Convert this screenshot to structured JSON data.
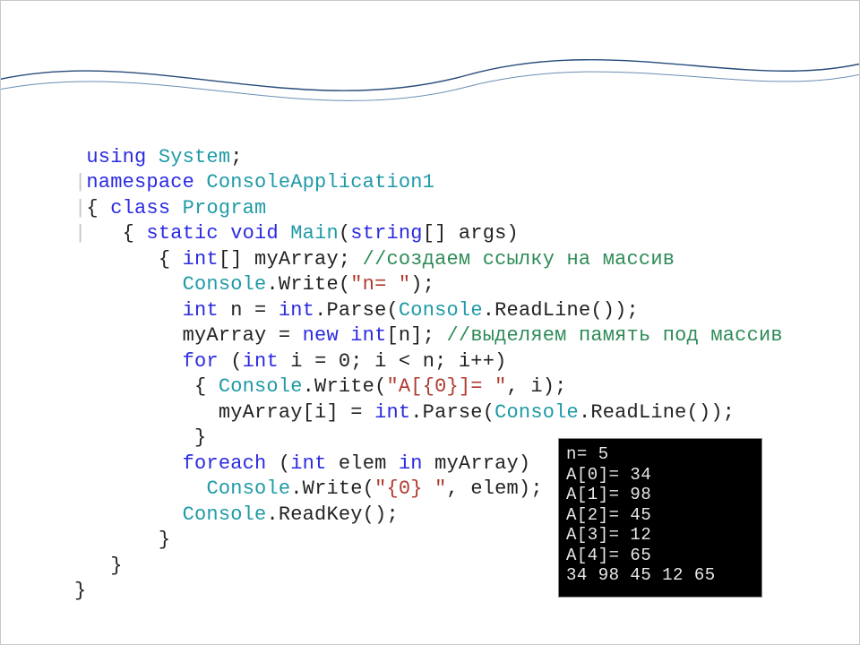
{
  "code": {
    "l1_kw": "using",
    "l1_type": " System",
    "l1_plain": ";",
    "l2_guide": "|",
    "l2_kw": "namespace",
    "l2_type": " ConsoleApplication1",
    "l3_guide": "|",
    "l3_p1": "{ ",
    "l3_kw": "class",
    "l3_type": " Program",
    "l4_guide": "|",
    "l4_p1": "   { ",
    "l4_kw1": "static",
    "l4_kw2": " void",
    "l4_type1": " Main",
    "l4_p2": "(",
    "l4_kw3": "string",
    "l4_p3": "[] args)",
    "l5_p1": "       { ",
    "l5_kw": "int",
    "l5_p2": "[] myArray; ",
    "l5_cmt": "//создаем ссылку на массив",
    "l6_p1": "         ",
    "l6_type": "Console",
    "l6_p2": ".Write(",
    "l6_str": "\"n= \"",
    "l6_p3": ");",
    "l7_p1": "         ",
    "l7_kw1": "int",
    "l7_p2": " n = ",
    "l7_kw2": "int",
    "l7_p3": ".Parse(",
    "l7_type": "Console",
    "l7_p4": ".ReadLine());",
    "l8_p1": "         myArray = ",
    "l8_kw1": "new",
    "l8_p2": " ",
    "l8_kw2": "int",
    "l8_p3": "[n]; ",
    "l8_cmt": "//выделяем память под массив",
    "l9_p1": "         ",
    "l9_kw1": "for",
    "l9_p2": " (",
    "l9_kw2": "int",
    "l9_p3": " i = 0; i < n; i++)",
    "l10_p1": "          { ",
    "l10_type": "Console",
    "l10_p2": ".Write(",
    "l10_str": "\"A[{0}]= \"",
    "l10_p3": ", i);",
    "l11_p1": "            myArray[i] = ",
    "l11_kw": "int",
    "l11_p2": ".Parse(",
    "l11_type": "Console",
    "l11_p3": ".ReadLine());",
    "l12_p1": "          }",
    "l13_p1": "         ",
    "l13_kw1": "foreach",
    "l13_p2": " (",
    "l13_kw2": "int",
    "l13_p3": " elem ",
    "l13_kw3": "in",
    "l13_p4": " myArray)",
    "l14_p1": "           ",
    "l14_type": "Console",
    "l14_p2": ".Write(",
    "l14_str": "\"{0} \"",
    "l14_p3": ", elem);",
    "l15_p1": "         ",
    "l15_type": "Console",
    "l15_p2": ".ReadKey();",
    "l16_p1": "       }",
    "l17_p1": "   }",
    "l18_p1": "}"
  },
  "console": {
    "l1": "n= 5",
    "l2": "A[0]= 34",
    "l3": "A[1]= 98",
    "l4": "A[2]= 45",
    "l5": "A[3]= 12",
    "l6": "A[4]= 65",
    "l7": "34 98 45 12 65"
  }
}
